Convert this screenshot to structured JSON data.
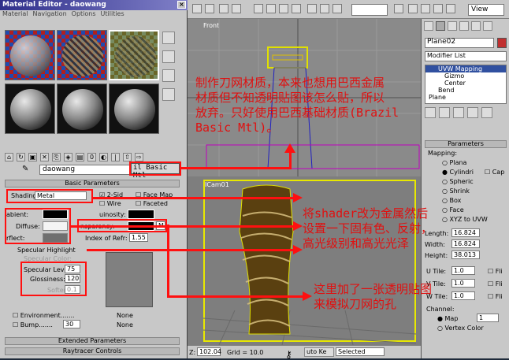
{
  "title": "Material Editor - daowang",
  "menu": [
    "Material",
    "Navigation",
    "Options",
    "Utilities"
  ],
  "material_name": "daowang",
  "material_type": "il Basic Mtl",
  "rollouts": {
    "basic": "Basic Parameters",
    "extended": "Extended Parameters",
    "raytracer": "Raytracer Controls"
  },
  "shading": {
    "label": "Shading:",
    "value": "Metal"
  },
  "checks": {
    "two_sided": "2-Sid",
    "wire": "Wire",
    "face_map": "Face Map",
    "faceted": "Faceted"
  },
  "color_labels": {
    "ambient": "abient:",
    "diffuse": "Diffuse:",
    "reflect": "rflect:",
    "luminosity": "uinosity:",
    "transparency": "nsparency:",
    "ior": "Index of Refr:"
  },
  "ior_value": "1.55",
  "trans_map": "M",
  "specular": {
    "header": "Specular Highlight",
    "spec_color": "Specular Color:",
    "level_label": "Specular Level:",
    "level": "75",
    "gloss_label": "Glossiness:",
    "gloss": "120",
    "soften_label": "Soften:",
    "soften": "0.1"
  },
  "maps": {
    "env_label": "Environment.......",
    "env_value": "None",
    "bump_label": "Bump.......",
    "bump_amount": "30",
    "bump_value": "None"
  },
  "topbar": {
    "view": "View"
  },
  "viewports": {
    "top_label": "Front",
    "persp_label": "ICam01"
  },
  "status": {
    "z_label": "Z:",
    "z_value": "102.04",
    "grid": "Grid = 10.0",
    "autokey": "uto Ke",
    "selected": "Selected"
  },
  "command_panel": {
    "object_name": "Plane02",
    "modifier_list": "Modifier List",
    "stack": [
      "UVW Mapping",
      "Gizmo",
      "Center",
      "Bend",
      "Plane"
    ],
    "params_header": "Parameters",
    "mapping_label": "Mapping:",
    "mapping_options": [
      "Plana",
      "Cylindri",
      "Spheric",
      "Shrink",
      "Box",
      "Face",
      "XYZ to UVW"
    ],
    "cap": "Cap",
    "length_label": "Length:",
    "length": "16.824",
    "width_label": "Width:",
    "width": "16.824",
    "height_label": "Height:",
    "height": "38.013",
    "utile_label": "U Tile:",
    "utile": "1.0",
    "vtile_label": "V Tile:",
    "vtile": "1.0",
    "wtile_label": "W Tile:",
    "wtile": "1.0",
    "flip": "Fli",
    "channel_label": "Channel:",
    "map_label": "Map",
    "map_value": "1",
    "vertex_color": "Vertex Color"
  },
  "annotations": {
    "a1_line1": "制作刀网材质，本来也想用巴西金属",
    "a1_line2": "材质但不知透明贴图该怎么贴，所以",
    "a1_line3": "放弃。只好使用巴西基础材质(Brazil",
    "a1_line4": "Basic Mtl)。",
    "a2_line1": "将shader改为金属然后",
    "a2_line2": "设置一下固有色、反射，",
    "a2_line3": "高光级别和高光光泽",
    "a3_line1": "这里加了一张透明贴图",
    "a3_line2": "来模拟刀网的孔"
  },
  "colors": {
    "annotation": "#e01010",
    "highlight_box": "#ff1010",
    "material_body": "#5a4010",
    "title_bar": "#2f2f8a"
  }
}
